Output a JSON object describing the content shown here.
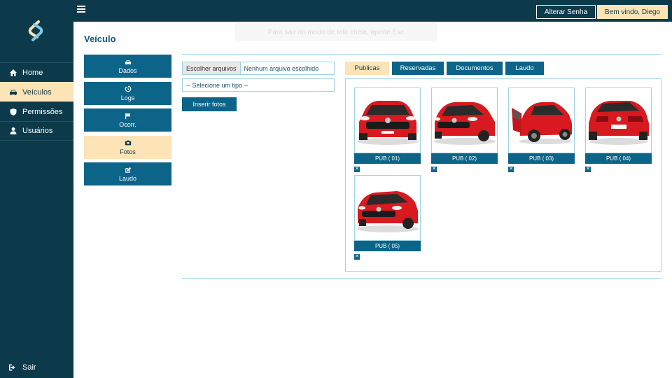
{
  "sidebar": {
    "items": [
      {
        "label": "Home",
        "icon": "home-icon"
      },
      {
        "label": "Veículos",
        "icon": "car-icon"
      },
      {
        "label": "Permissões",
        "icon": "shield-icon"
      },
      {
        "label": "Usuários",
        "icon": "user-icon"
      }
    ],
    "logout_label": "Sair"
  },
  "topbar": {
    "change_password": "Alterar Senha",
    "welcome": "Bem vindo, Diego"
  },
  "toast": {
    "text": "Para sair do modo de tela cheia, aperte Esc"
  },
  "page": {
    "title": "Veículo"
  },
  "side_menu": [
    {
      "label": "Dados",
      "icon": "car-icon"
    },
    {
      "label": "Logs",
      "icon": "history-icon"
    },
    {
      "label": "Ocorr.",
      "icon": "flag-icon"
    },
    {
      "label": "Fotos",
      "icon": "camera-icon"
    },
    {
      "label": "Laudo",
      "icon": "edit-icon"
    }
  ],
  "upload": {
    "file_button": "Escolher arquivos",
    "file_status": "Nenhum arquivo escolhido",
    "type_select": "-- Selecione um tipo --",
    "insert_button": "Inserir fotos"
  },
  "tabs": [
    {
      "label": "Publicas"
    },
    {
      "label": "Reservadas"
    },
    {
      "label": "Documentos"
    },
    {
      "label": "Laudo"
    }
  ],
  "photos": [
    {
      "label": "PUB ( 01)"
    },
    {
      "label": "PUB ( 02)"
    },
    {
      "label": "PUB ( 03)"
    },
    {
      "label": "PUB ( 04)"
    },
    {
      "label": "PUB ( 05)"
    }
  ],
  "colors": {
    "sidebar_bg": "#0c3a4a",
    "accent": "#fde4b6",
    "button_blue": "#0c6488",
    "border": "#9fd3e3",
    "car_red": "#d8191f"
  }
}
